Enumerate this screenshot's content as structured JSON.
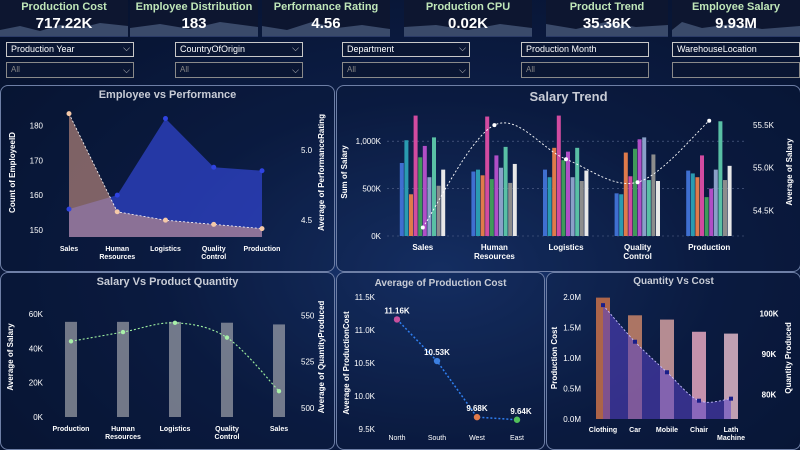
{
  "kpis": [
    {
      "title": "Production Cost",
      "value": "717.22K"
    },
    {
      "title": "Employee Distribution",
      "value": "183"
    },
    {
      "title": "Performance Rating",
      "value": "4.56"
    },
    {
      "title": "Production CPU",
      "value": "0.02K"
    },
    {
      "title": "Product Trend",
      "value": "35.36K"
    },
    {
      "title": "Employee Salary",
      "value": "9.93M"
    }
  ],
  "filters": [
    {
      "label": "Production Year",
      "value": "All"
    },
    {
      "label": "CountryOfOrigin",
      "value": "All"
    },
    {
      "label": "Department",
      "value": "All"
    },
    {
      "label": "Production Month",
      "value": "All"
    },
    {
      "label": "WarehouseLocation",
      "value": ""
    }
  ],
  "panels": {
    "emp_perf": {
      "title": "Employee vs Performance"
    },
    "salary_trend": {
      "title": "Salary Trend"
    },
    "salary_qty": {
      "title": "Salary Vs Product Quantity"
    },
    "avg_prod_cost": {
      "title": "Average of Production Cost"
    },
    "qty_cost": {
      "title": "Quantity Vs Cost"
    }
  },
  "chart_data": [
    {
      "id": "emp_perf",
      "type": "area",
      "categories": [
        "Sales",
        "Human Resources",
        "Logistics",
        "Quality Control",
        "Production"
      ],
      "ylabel": "Count of EmployeeID",
      "y2label": "Average of PerformanceRating",
      "yticks": [
        "150",
        "160",
        "170",
        "180"
      ],
      "y2ticks": [
        "4.5",
        "5.0"
      ],
      "ylim": [
        148,
        185
      ],
      "y2lim": [
        4.38,
        5.3
      ],
      "series": [
        {
          "values": [
            156,
            160,
            182,
            168,
            167
          ],
          "color": "#2f43c8",
          "axis": "left"
        },
        {
          "values": [
            5.26,
            4.56,
            4.5,
            4.47,
            4.44
          ],
          "color": "#e0a08a",
          "axis": "right"
        }
      ]
    },
    {
      "id": "salary_trend",
      "type": "bar",
      "categories": [
        "Sales",
        "Human Resources",
        "Logistics",
        "Quality Control",
        "Production"
      ],
      "ylabel": "Sum of Salary",
      "y2label": "Average of Salary",
      "yticks": [
        "0K",
        "500K",
        "1,000K"
      ],
      "y2ticks": [
        "54.5K",
        "55.0K",
        "55.5K"
      ],
      "ylim": [
        0,
        1350000
      ],
      "y2lim": [
        54200,
        55700
      ],
      "bar_colors": [
        "#3f6fd0",
        "#2a9bb0",
        "#e07a4a",
        "#d24ba0",
        "#3f9a5a",
        "#b04ec6",
        "#8aa0c8",
        "#59c0a5",
        "#8c8c8c",
        "#e8e8e8"
      ],
      "groups": [
        [
          770,
          1010,
          440,
          1270,
          830,
          950,
          620,
          1040,
          530,
          700
        ],
        [
          680,
          700,
          640,
          1260,
          600,
          850,
          720,
          940,
          560,
          760
        ],
        [
          700,
          620,
          930,
          1270,
          800,
          890,
          620,
          930,
          580,
          690
        ],
        [
          450,
          440,
          880,
          630,
          920,
          1020,
          1040,
          590,
          860,
          580
        ],
        [
          690,
          660,
          620,
          850,
          410,
          500,
          700,
          1210,
          590,
          740
        ]
      ],
      "line": [
        54300,
        55500,
        55100,
        54830,
        55550
      ]
    },
    {
      "id": "salary_qty",
      "type": "bar",
      "categories": [
        "Production",
        "Human Resources",
        "Logistics",
        "Quality Control",
        "Sales"
      ],
      "ylabel": "Average of Salary",
      "y2label": "Average of QuantityProduced",
      "yticks": [
        "0K",
        "20K",
        "40K",
        "60K"
      ],
      "y2ticks": [
        "500",
        "525",
        "550"
      ],
      "ylim": [
        0,
        70000
      ],
      "y2lim": [
        495,
        560
      ],
      "values": [
        55500,
        55500,
        55500,
        55000,
        54000
      ],
      "line": [
        536,
        541,
        546,
        538,
        509
      ]
    },
    {
      "id": "avg_prod_cost",
      "type": "scatter",
      "categories": [
        "North",
        "South",
        "West",
        "East"
      ],
      "ylabel": "Average of ProductionCost",
      "yticks": [
        "9.5K",
        "10.0K",
        "10.5K",
        "11.0K",
        "11.5K"
      ],
      "ylim": [
        9.5,
        11.5
      ],
      "values": [
        11.16,
        10.53,
        9.68,
        9.64
      ],
      "data_labels": [
        "11.16K",
        "10.53K",
        "9.68K",
        "9.64K"
      ],
      "point_colors": [
        "#c8509e",
        "#3c7fe0",
        "#e07a4a",
        "#52c05a"
      ]
    },
    {
      "id": "qty_cost",
      "type": "bar",
      "categories": [
        "Clothing",
        "Car",
        "Mobile",
        "Chair",
        "Lath Machine"
      ],
      "ylabel": "Production Cost",
      "y2label": "Quantity Produced",
      "yticks": [
        "0.0M",
        "0.5M",
        "1.0M",
        "1.5M",
        "2.0M"
      ],
      "y2ticks": [
        "80K",
        "90K",
        "100K"
      ],
      "ylim": [
        0,
        2000000
      ],
      "y2lim": [
        74000,
        104000
      ],
      "values": [
        1990000,
        1700000,
        1630000,
        1430000,
        1400000
      ],
      "bar_colors": [
        "#c9714a",
        "#c9856a",
        "#d4a0a0",
        "#e6a8c0",
        "#e0b8c8"
      ],
      "line": [
        102000,
        93000,
        85500,
        78500,
        79000
      ]
    }
  ]
}
